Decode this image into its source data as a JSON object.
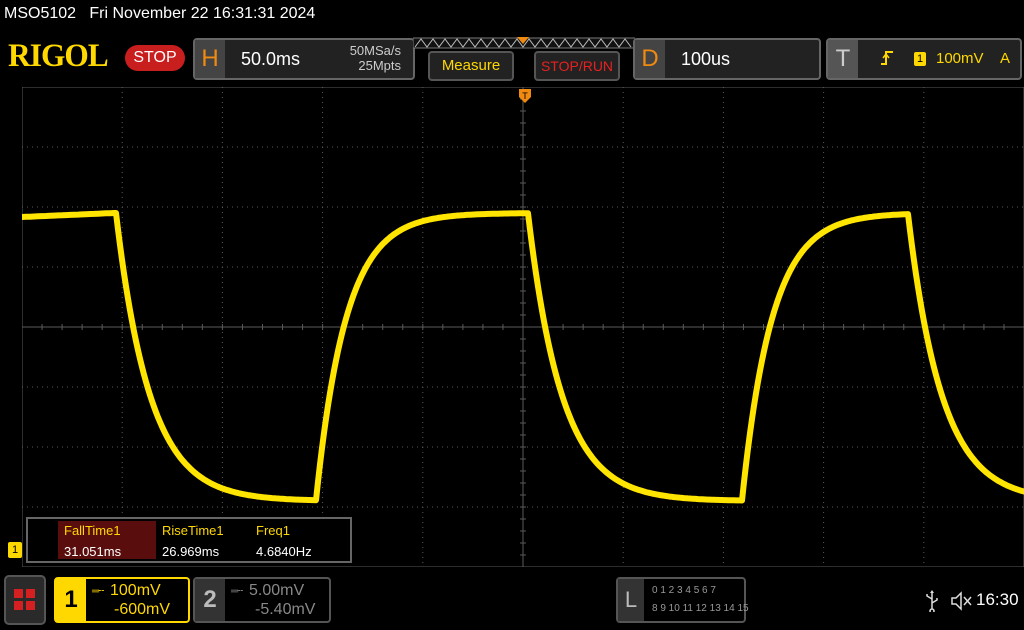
{
  "status": {
    "model": "MSO5102",
    "datetime": "Fri November 22 16:31:31 2024"
  },
  "header": {
    "logo": "RIGOL",
    "run_state": "STOP",
    "horizontal": {
      "letter": "H",
      "timebase": "50.0ms",
      "sample_rate": "50MSa/s",
      "memory_depth": "25Mpts"
    },
    "measure_label": "Measure",
    "stoprun_label": "STOP/RUN",
    "delay": {
      "letter": "D",
      "value": "100us"
    },
    "trigger": {
      "letter": "T",
      "edge_icon": "rising-edge-icon",
      "source": "1",
      "level": "100mV",
      "mode": "A"
    }
  },
  "colors": {
    "ch1": "#ffd800",
    "accent": "#f08a10",
    "stop": "#c91e1e",
    "grid": "#5a5a5a"
  },
  "measurements": [
    {
      "label": "FallTime1",
      "value": "31.051ms"
    },
    {
      "label": "RiseTime1",
      "value": "26.969ms"
    },
    {
      "label": "Freq1",
      "value": "4.6840Hz"
    }
  ],
  "ch1_marker": "1",
  "channels": [
    {
      "num": "1",
      "coupling_icon": "dc-coupling-icon",
      "scale": "100mV",
      "offset": "-600mV",
      "active": true
    },
    {
      "num": "2",
      "coupling_icon": "dc-coupling-icon",
      "scale": "5.00mV",
      "offset": "-5.40mV",
      "active": false
    }
  ],
  "logic": {
    "letter": "L",
    "row1": "0 1 2 3  4 5 6 7",
    "row2": "8 9 10 11 12 13 14 15"
  },
  "clock": "16:30"
}
